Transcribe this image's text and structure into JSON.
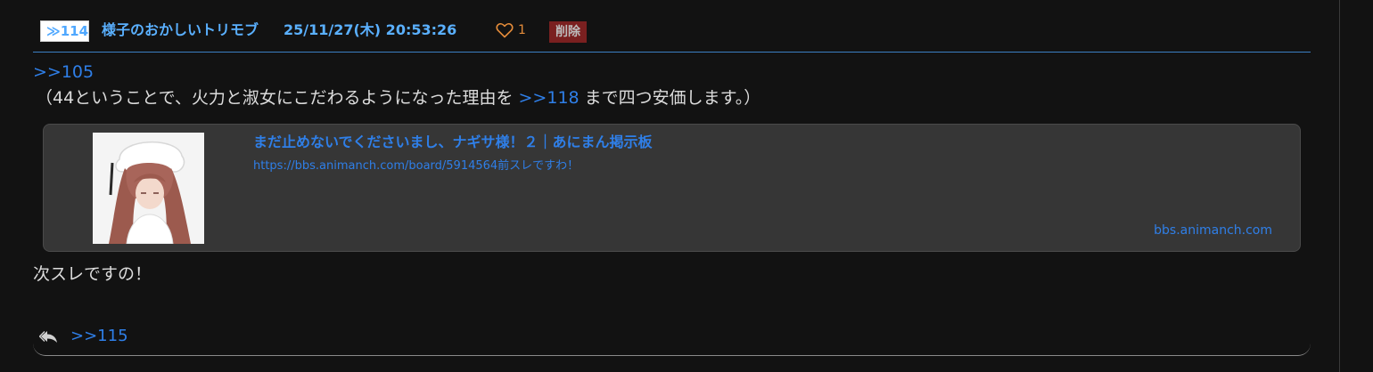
{
  "post": {
    "number_label": "≫114",
    "author": "様子のおかしいトリモブ",
    "date": "25/11/27(木) 20:53:26",
    "like_count": "1",
    "delete_label": "削除",
    "anchor": ">>105",
    "line2_before": "（44ということで、火力と淑女にこだわるようになった理由を ",
    "line2_anchor": ">>118",
    "line2_after": " まで四つ安価します。）",
    "body_end": "次スレですの！"
  },
  "link_card": {
    "title": "まだ止めないでくださいまし、ナギサ様！２｜あにまん掲示板",
    "url": "https://bbs.animanch.com/board/5914564前スレですわ！",
    "domain": "bbs.animanch.com",
    "thumbnail": "anime-girl-thumbnail"
  },
  "replies": {
    "icon": "reply-icon",
    "link": ">>115"
  },
  "colors": {
    "background": "#121212",
    "link": "#2f7fe8",
    "header_text": "#5ab0ff",
    "header_rule": "#3b7fc4",
    "like": "#e58c3a",
    "delete_bg": "#7a2020",
    "card_bg": "#363636",
    "body_text": "#dcdcdc"
  }
}
